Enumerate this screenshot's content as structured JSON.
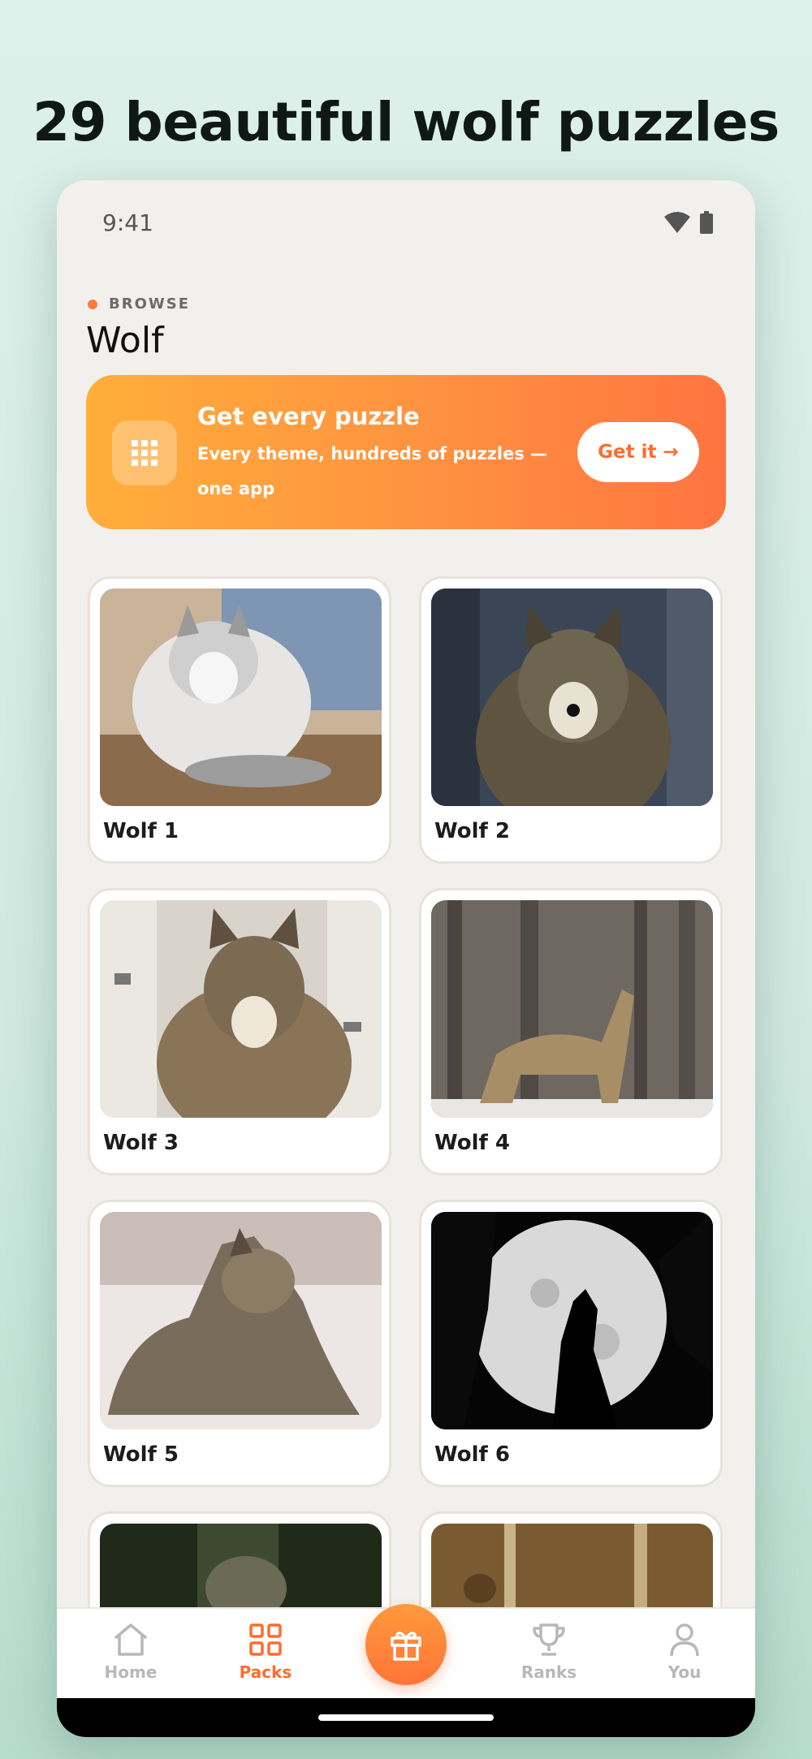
{
  "headline": "29 beautiful wolf puzzles",
  "status": {
    "time": "9:41"
  },
  "section": {
    "eyebrow": "BROWSE",
    "title": "Wolf"
  },
  "promo": {
    "title": "Get every puzzle",
    "subtitle": "Every theme, hundreds of puzzles — one app",
    "cta": "Get it →",
    "icon": "grid-icon"
  },
  "puzzles": [
    {
      "label": "Wolf 1"
    },
    {
      "label": "Wolf 2"
    },
    {
      "label": "Wolf 3"
    },
    {
      "label": "Wolf 4"
    },
    {
      "label": "Wolf 5"
    },
    {
      "label": "Wolf 6"
    },
    {
      "label": ""
    },
    {
      "label": ""
    }
  ],
  "nav": {
    "items": [
      {
        "label": "Home",
        "icon": "home-icon"
      },
      {
        "label": "Packs",
        "icon": "packs-icon"
      },
      {
        "label": "",
        "icon": "gift-icon"
      },
      {
        "label": "Ranks",
        "icon": "trophy-icon"
      },
      {
        "label": "You",
        "icon": "user-icon"
      }
    ],
    "active": "Packs"
  },
  "colors": {
    "accent": "#ff6b2e",
    "promo_start": "#ffae3a",
    "promo_end": "#ff7440",
    "background": "#ddf1ea"
  }
}
